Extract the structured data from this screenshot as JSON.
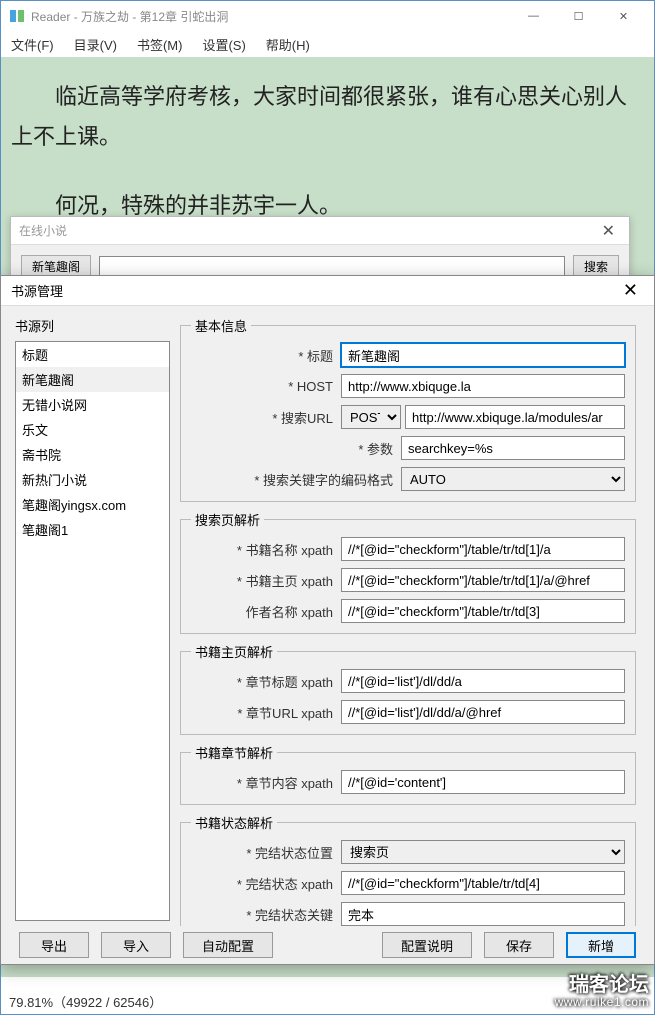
{
  "window": {
    "title": "Reader - 万族之劫 - 第12章 引蛇出洞"
  },
  "menu": [
    "文件(F)",
    "目录(V)",
    "书签(M)",
    "设置(S)",
    "帮助(H)"
  ],
  "reader": {
    "p1": "临近高等学府考核，大家时间都很紧张，谁有心思关心别人上不上课。",
    "p2": "何况，特殊的并非苏宇一人。"
  },
  "status": "79.81%（49922 / 62546）",
  "online_dialog": {
    "title": "在线小说",
    "btn_left": "新笔趣阁",
    "btn_right": "搜索"
  },
  "src_dialog": {
    "title": "书源管理",
    "list_title": "书源列",
    "sources": [
      "标题",
      "新笔趣阁",
      "无错小说网",
      "乐文",
      "斋书院",
      "新热门小说",
      "笔趣阁yingsx.com",
      "笔趣阁1"
    ],
    "selected_index": 1,
    "groups": {
      "basic": {
        "legend": "基本信息",
        "title_label": "* 标题",
        "title_value": "新笔趣阁",
        "host_label": "* HOST",
        "host_value": "http://www.xbiquge.la",
        "search_label": "* 搜索URL",
        "search_method": "POST",
        "search_value": "http://www.xbiquge.la/modules/ar",
        "param_label": "* 参数",
        "param_value": "searchkey=%s",
        "encoding_label": "* 搜索关键字的编码格式",
        "encoding_value": "AUTO"
      },
      "search_parse": {
        "legend": "搜索页解析",
        "name_label": "* 书籍名称 xpath",
        "name_value": "//*[@id=\"checkform\"]/table/tr/td[1]/a",
        "home_label": "* 书籍主页 xpath",
        "home_value": "//*[@id=\"checkform\"]/table/tr/td[1]/a/@href",
        "author_label": "作者名称 xpath",
        "author_value": "//*[@id=\"checkform\"]/table/tr/td[3]"
      },
      "home_parse": {
        "legend": "书籍主页解析",
        "chap_title_label": "* 章节标题 xpath",
        "chap_title_value": "//*[@id='list']/dl/dd/a",
        "chap_url_label": "* 章节URL xpath",
        "chap_url_value": "//*[@id='list']/dl/dd/a/@href"
      },
      "chapter_parse": {
        "legend": "书籍章节解析",
        "content_label": "* 章节内容 xpath",
        "content_value": "//*[@id='content']"
      },
      "status_parse": {
        "legend": "书籍状态解析",
        "pos_label": "* 完结状态位置",
        "pos_value": "搜索页",
        "xpath_label": "* 完结状态 xpath",
        "xpath_value": "//*[@id=\"checkform\"]/table/tr/td[4]",
        "key_label": "* 完结状态关键",
        "key_value": "完本"
      }
    },
    "footer": {
      "export": "导出",
      "import": "导入",
      "auto": "自动配置",
      "desc": "配置说明",
      "save": "保存",
      "add": "新增"
    }
  },
  "watermark": {
    "text": "瑞客论坛",
    "url": "www.ruike1.com"
  }
}
